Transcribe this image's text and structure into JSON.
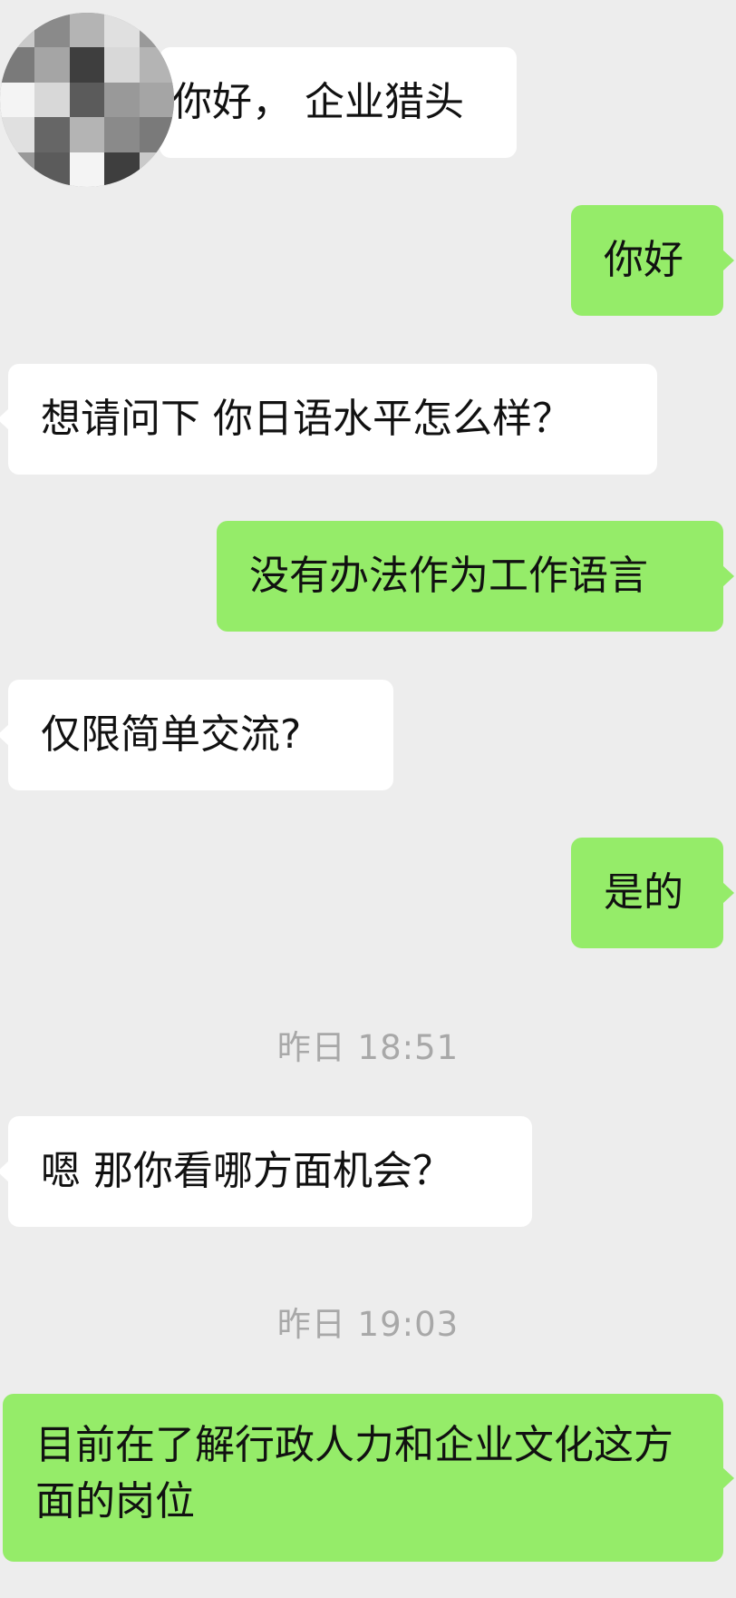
{
  "avatar": {
    "icon": "pixelated-avatar-icon"
  },
  "messages": [
    {
      "direction": "in",
      "text": "你好，  企业猎头"
    },
    {
      "direction": "out",
      "text": "你好"
    },
    {
      "direction": "in",
      "text": "想请问下 你日语水平怎么样？"
    },
    {
      "direction": "out",
      "text": "没有办法作为工作语言"
    },
    {
      "direction": "in",
      "text": "仅限简单交流?"
    },
    {
      "direction": "out",
      "text": "是的"
    },
    {
      "direction": "in",
      "text": "嗯  那你看哪方面机会？"
    },
    {
      "direction": "out",
      "text": "目前在了解行政人力和企业文化这方面的岗位"
    }
  ],
  "timestamps": [
    "昨日 18:51",
    "昨日 19:03"
  ],
  "colors": {
    "background": "#ededed",
    "incoming_bubble": "#ffffff",
    "outgoing_bubble": "#95ec69",
    "timestamp_text": "#a8a8a8"
  }
}
